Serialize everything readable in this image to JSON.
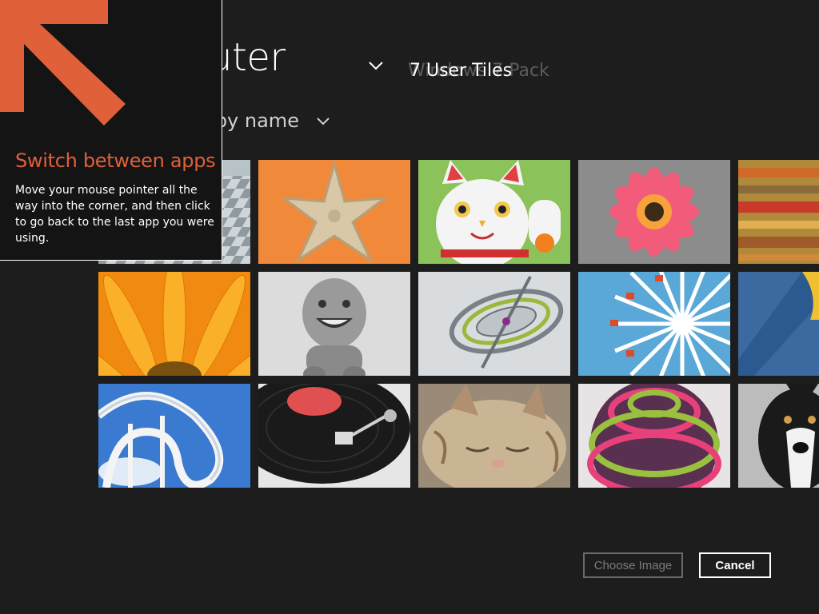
{
  "header": {
    "location_title": "Computer",
    "folder_name": "7 User Tiles",
    "folder_name_ghost": "Windows 7 Pack",
    "sort_label": "Sort by name"
  },
  "tiles": [
    {
      "label": "checkered-floor",
      "row": 1,
      "col": 1
    },
    {
      "label": "starfish",
      "row": 1,
      "col": 2
    },
    {
      "label": "lucky-cat",
      "row": 1,
      "col": 3
    },
    {
      "label": "pink-flower",
      "row": 1,
      "col": 4
    },
    {
      "label": "striped-fabric",
      "row": 1,
      "col": 5
    },
    {
      "label": "orange-daisy",
      "row": 2,
      "col": 1
    },
    {
      "label": "toy-figure",
      "row": 2,
      "col": 2
    },
    {
      "label": "gyroscope",
      "row": 2,
      "col": 3
    },
    {
      "label": "ferris-wheel",
      "row": 2,
      "col": 4
    },
    {
      "label": "blue-yellow-shape",
      "row": 2,
      "col": 5
    },
    {
      "label": "roller-coaster",
      "row": 3,
      "col": 1
    },
    {
      "label": "record-player",
      "row": 3,
      "col": 2
    },
    {
      "label": "sleeping-kitten",
      "row": 3,
      "col": 3
    },
    {
      "label": "striped-ball",
      "row": 3,
      "col": 4
    },
    {
      "label": "border-collie",
      "row": 3,
      "col": 5
    }
  ],
  "tip": {
    "title": "Switch between apps",
    "body": "Move your mouse pointer all the way into the corner, and then click to go back to the last app you were using.",
    "accent_color": "#e0603a",
    "arrow_icon": "arrow-up-left-icon"
  },
  "buttons": {
    "choose_image": "Choose Image",
    "cancel": "Cancel"
  }
}
